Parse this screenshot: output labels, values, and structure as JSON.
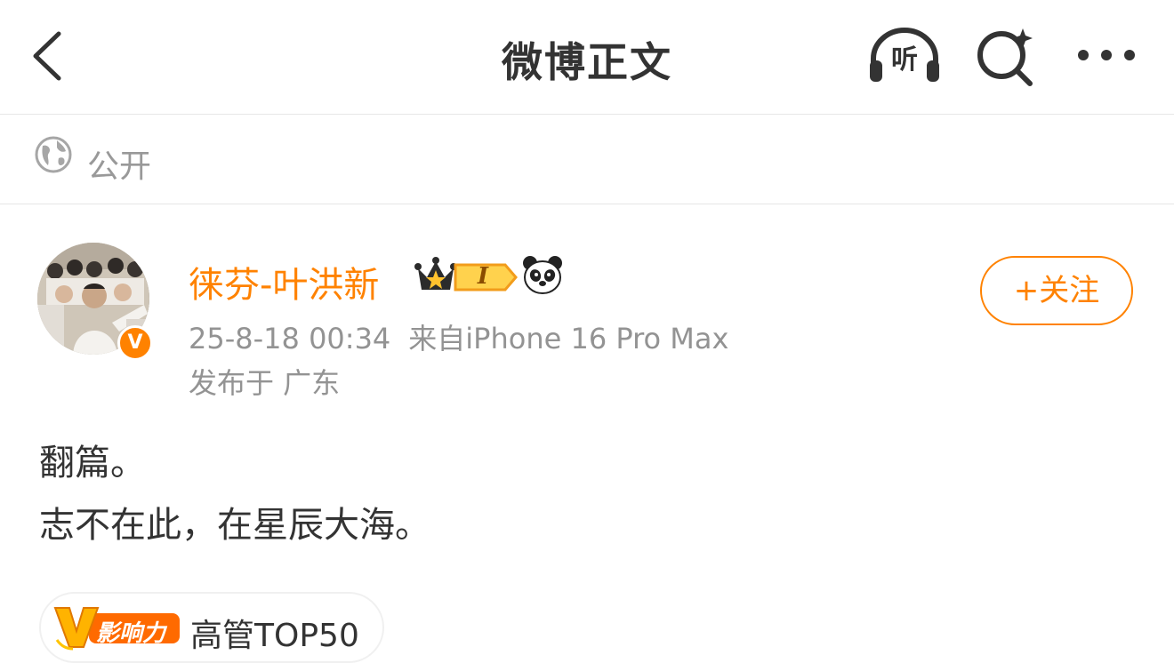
{
  "navbar": {
    "title": "微博正文",
    "back_icon": "chevron-left-icon",
    "listen_label": "听",
    "listen_icon": "headphones-icon",
    "search_icon": "search-sparkle-icon",
    "more_icon": "more-dots-icon"
  },
  "visibility": {
    "icon": "globe-icon",
    "label": "公开"
  },
  "author": {
    "name": "徕芬-叶洪新",
    "verified_mark": "V",
    "level_badge": "I",
    "timestamp": "25-8-18 00:34",
    "source": "来自iPhone 16 Pro Max",
    "location": "发布于 广东",
    "follow_label": "+关注"
  },
  "post": {
    "lines": [
      "翻篇。",
      "志不在此，在星辰大海。"
    ]
  },
  "influence": {
    "badge_letter": "V",
    "badge_text": "影响力",
    "label": "高管TOP50"
  },
  "colors": {
    "accent": "#ff8200",
    "meta_text": "#939393",
    "body_text": "#333333"
  }
}
